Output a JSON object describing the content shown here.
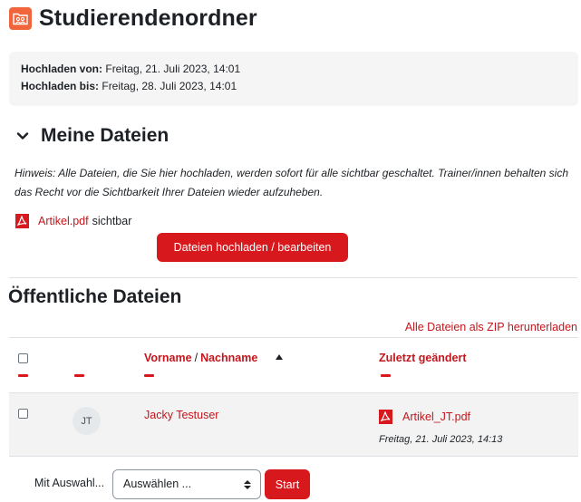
{
  "page": {
    "title": "Studierendenordner",
    "icon": "folder-users-icon",
    "accent_color": "#f0653c"
  },
  "dates": {
    "from_label": "Hochladen von:",
    "from_value": "Freitag, 21. Juli 2023, 14:01",
    "to_label": "Hochladen bis:",
    "to_value": "Freitag, 28. Juli 2023, 14:01"
  },
  "my_files": {
    "title": "Meine Dateien",
    "hint": "Hinweis: Alle Dateien, die Sie hier hochladen, werden sofort für alle sichtbar geschaltet. Trainer/innen behalten sich das Recht vor die Sichtbarkeit Ihrer Dateien wieder aufzuheben.",
    "file_name": "Artikel.pdf",
    "file_status": "sichtbar",
    "upload_button": "Dateien hochladen / bearbeiten"
  },
  "public_files": {
    "title": "Öffentliche Dateien",
    "zip_link": "Alle Dateien als ZIP herunterladen",
    "columns": {
      "firstname": "Vorname",
      "separator": "/",
      "lastname": "Nachname",
      "modified": "Zuletzt geändert"
    },
    "rows": [
      {
        "initials": "JT",
        "name": "Jacky Testuser",
        "file": "Artikel_JT.pdf",
        "date": "Freitag, 21. Juli 2023, 14:13"
      }
    ]
  },
  "bulk": {
    "label": "Mit Auswahl...",
    "select_value": "Auswählen ...",
    "start_button": "Start"
  },
  "colors": {
    "brand_red": "#d7191e",
    "link_red": "#c4161c"
  }
}
